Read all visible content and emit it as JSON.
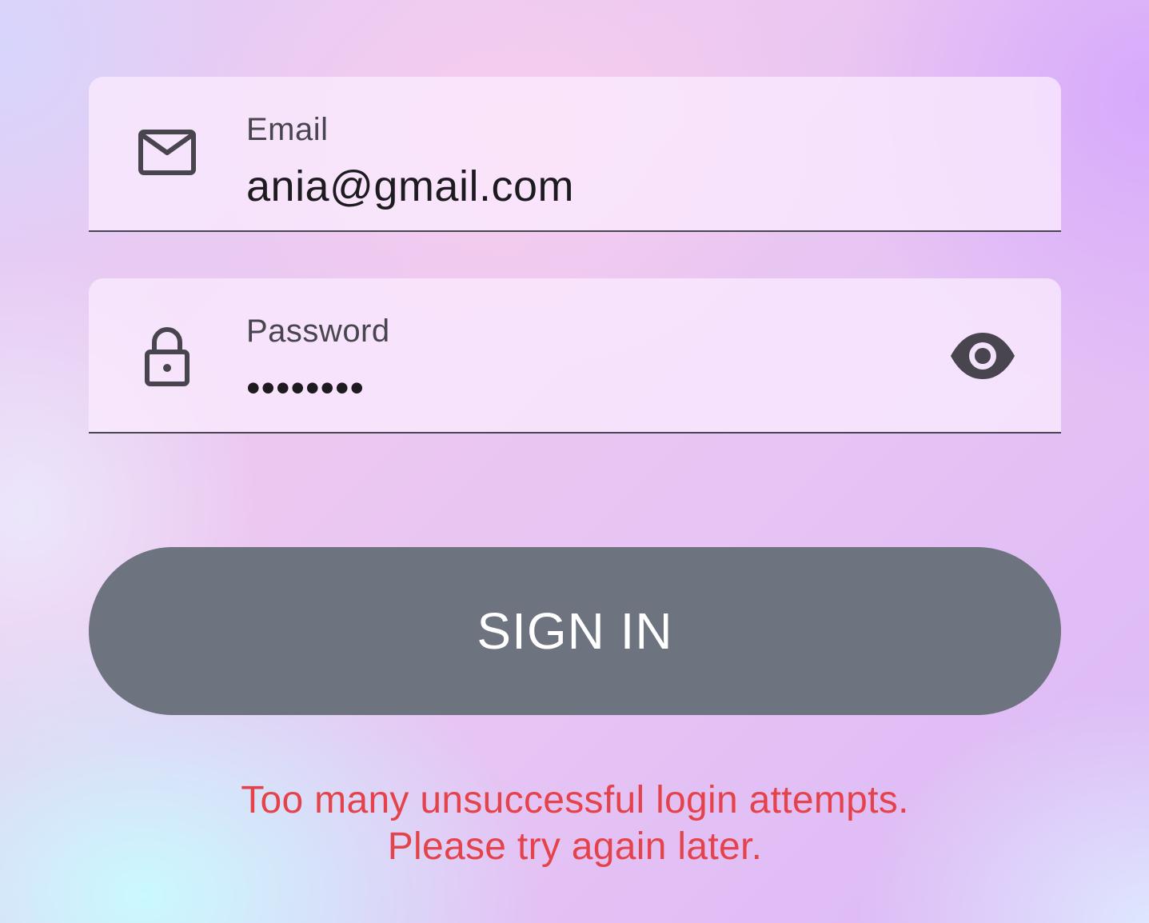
{
  "form": {
    "email": {
      "label": "Email",
      "value": "ania@gmail.com",
      "icon": "mail-icon"
    },
    "password": {
      "label": "Password",
      "value": "••••••••",
      "icon": "lock-icon",
      "toggle_icon": "eye-icon"
    },
    "submit_label": "SIGN IN",
    "error": {
      "line1": "Too many unsuccessful login attempts.",
      "line2": "Please try again later."
    }
  },
  "colors": {
    "button": "#6e7380",
    "error": "#e5434b",
    "field_bg": "#faeafe",
    "icon": "#49454f"
  }
}
